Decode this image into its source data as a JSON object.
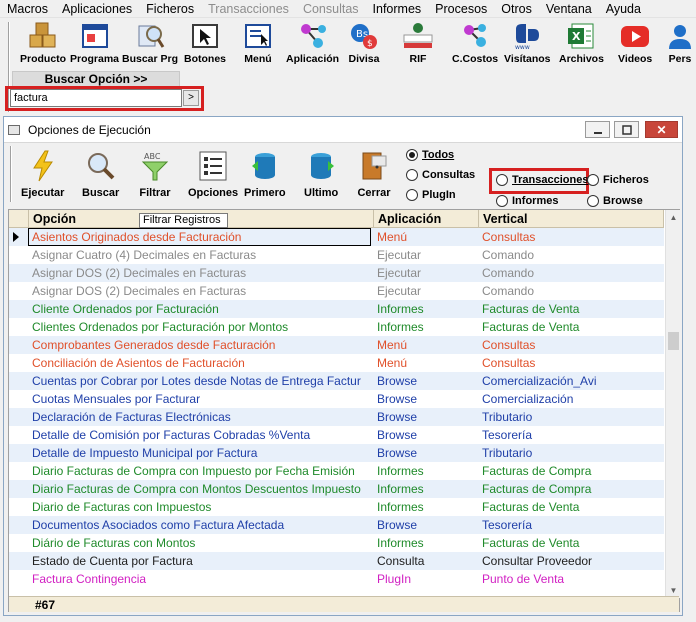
{
  "menu": [
    {
      "label": "Macros",
      "enabled": true
    },
    {
      "label": "Aplicaciones",
      "enabled": true
    },
    {
      "label": "Ficheros",
      "enabled": true
    },
    {
      "label": "Transacciones",
      "enabled": false
    },
    {
      "label": "Consultas",
      "enabled": false
    },
    {
      "label": "Informes",
      "enabled": true
    },
    {
      "label": "Procesos",
      "enabled": true
    },
    {
      "label": "Otros",
      "enabled": true
    },
    {
      "label": "Ventana",
      "enabled": true
    },
    {
      "label": "Ayuda",
      "enabled": true
    }
  ],
  "toolbar": {
    "producto": "Producto",
    "programa": "Programa",
    "buscar_prg": "Buscar Prg",
    "botones": "Botones",
    "menu": "Menú",
    "aplicacion": "Aplicación",
    "divisa": "Divisa",
    "rif": "RIF",
    "ccostos": "C.Costos",
    "visitanos": "Visítanos",
    "archivos": "Archivos",
    "videos": "Videos",
    "pers": "Pers"
  },
  "search": {
    "header": "Buscar Opción >>",
    "value": "factura",
    "go_label": ">"
  },
  "window": {
    "title": "Opciones de Ejecución",
    "close_glyph": "✕",
    "tools": {
      "ejecutar": "Ejecutar",
      "buscar": "Buscar",
      "filtrar": "Filtrar",
      "opciones": "Opciones",
      "primero": "Primero",
      "ultimo": "Ultimo",
      "cerrar": "Cerrar"
    },
    "filters": {
      "todos": "Todos",
      "consultas": "Consultas",
      "plugin": "PlugIn",
      "transacciones": "Transacciones",
      "informes": "Informes",
      "ficheros": "Ficheros",
      "browse": "Browse",
      "selected": "Todos"
    },
    "tooltip": "Filtrar Registros",
    "grid": {
      "headers": {
        "opcion": "Opción",
        "aplicacion": "Aplicación",
        "vertical": "Vertical"
      },
      "footer_count": "#67",
      "colors": {
        "menu": "#e0502a",
        "ejecutar": "#8a8a8a",
        "informes": "#1f8a2a",
        "browse": "#1f3fa8",
        "consulta": "#202020",
        "plugin": "#d11fc2"
      },
      "rows": [
        {
          "opcion": "Asientos Originados desde Facturación",
          "aplicacion": "Menú",
          "vertical": "Consultas",
          "kind": "menu"
        },
        {
          "opcion": "Asignar Cuatro (4) Decimales en Facturas",
          "aplicacion": "Ejecutar",
          "vertical": "Comando",
          "kind": "ejecutar"
        },
        {
          "opcion": "Asignar DOS (2) Decimales en Facturas",
          "aplicacion": "Ejecutar",
          "vertical": "Comando",
          "kind": "ejecutar"
        },
        {
          "opcion": "Asignar DOS (2) Decimales en Facturas",
          "aplicacion": "Ejecutar",
          "vertical": "Comando",
          "kind": "ejecutar"
        },
        {
          "opcion": "Cliente Ordenados por Facturación",
          "aplicacion": "Informes",
          "vertical": "Facturas de Venta",
          "kind": "informes"
        },
        {
          "opcion": "Clientes Ordenados por Facturación por Montos",
          "aplicacion": "Informes",
          "vertical": "Facturas de Venta",
          "kind": "informes"
        },
        {
          "opcion": "Comprobantes Generados desde Facturación",
          "aplicacion": "Menú",
          "vertical": "Consultas",
          "kind": "menu"
        },
        {
          "opcion": "Conciliación de Asientos de Facturación",
          "aplicacion": "Menú",
          "vertical": "Consultas",
          "kind": "menu"
        },
        {
          "opcion": "Cuentas por Cobrar por Lotes desde Notas de Entrega Factur",
          "aplicacion": "Browse",
          "vertical": "Comercialización_Avi",
          "kind": "browse"
        },
        {
          "opcion": "Cuotas Mensuales por Facturar",
          "aplicacion": "Browse",
          "vertical": "Comercialización",
          "kind": "browse"
        },
        {
          "opcion": "Declaración de Facturas Electrónicas",
          "aplicacion": "Browse",
          "vertical": "Tributario",
          "kind": "browse"
        },
        {
          "opcion": "Detalle de Comisión por Facturas Cobradas   %Venta",
          "aplicacion": "Browse",
          "vertical": "Tesorería",
          "kind": "browse"
        },
        {
          "opcion": "Detalle de Impuesto Municipal por Factura",
          "aplicacion": "Browse",
          "vertical": "Tributario",
          "kind": "browse"
        },
        {
          "opcion": "Diario Facturas de Compra con Impuesto por Fecha Emisión",
          "aplicacion": "Informes",
          "vertical": "Facturas de Compra",
          "kind": "informes"
        },
        {
          "opcion": "Diario Facturas de Compra con Montos  Descuentos Impuesto",
          "aplicacion": "Informes",
          "vertical": "Facturas de Compra",
          "kind": "informes"
        },
        {
          "opcion": "Diario de Facturas con Impuestos",
          "aplicacion": "Informes",
          "vertical": "Facturas de Venta",
          "kind": "informes"
        },
        {
          "opcion": "Documentos Asociados como Factura Afectada",
          "aplicacion": "Browse",
          "vertical": "Tesorería",
          "kind": "browse"
        },
        {
          "opcion": "Diário de Facturas con Montos",
          "aplicacion": "Informes",
          "vertical": "Facturas de Venta",
          "kind": "informes"
        },
        {
          "opcion": "Estado de Cuenta por Factura",
          "aplicacion": "Consulta",
          "vertical": "Consultar Proveedor",
          "kind": "consulta"
        },
        {
          "opcion": "Factura Contingencia",
          "aplicacion": "PlugIn",
          "vertical": "Punto de Venta",
          "kind": "plugin"
        }
      ]
    }
  }
}
